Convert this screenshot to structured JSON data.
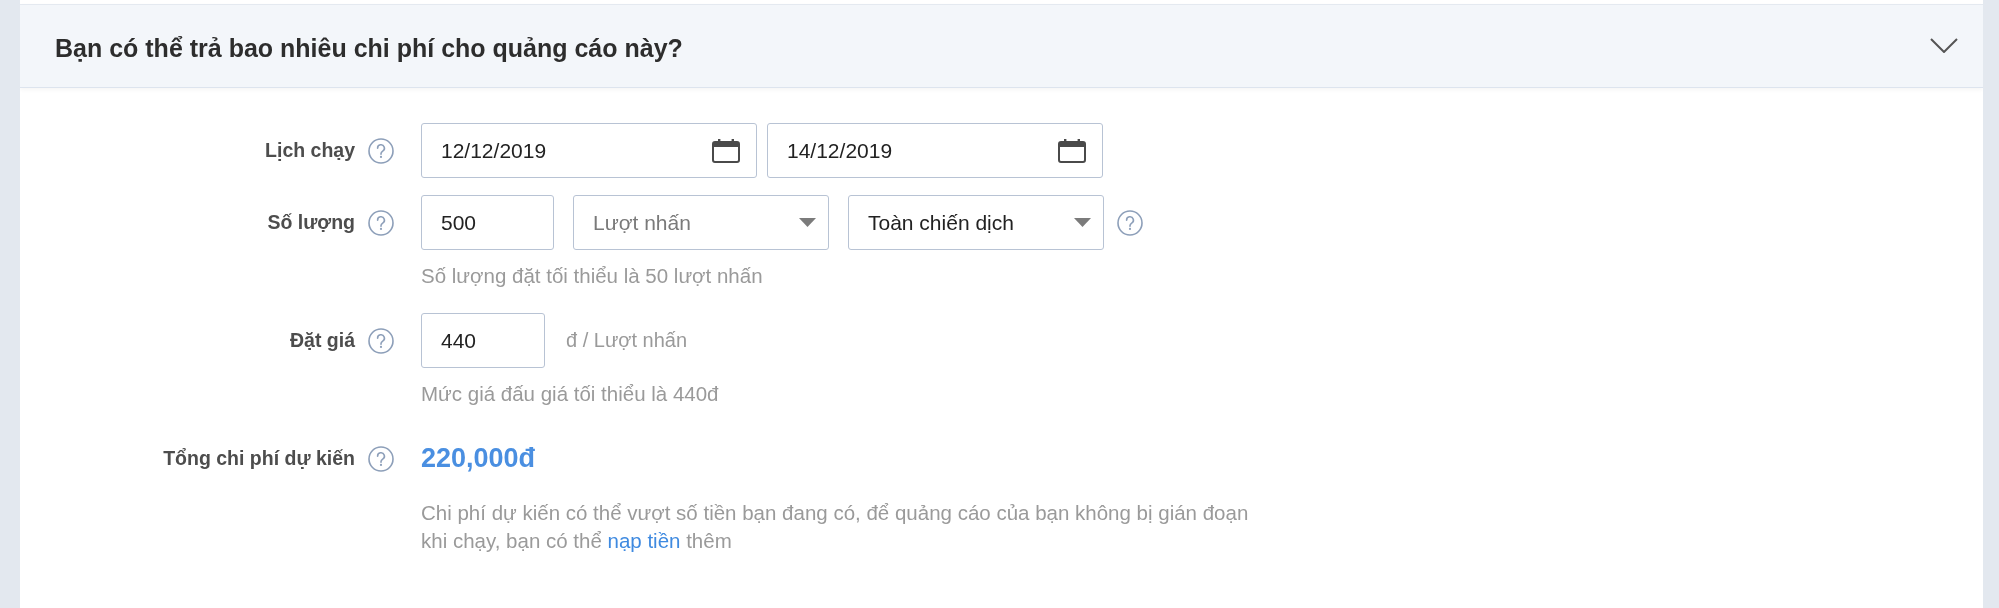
{
  "section": {
    "title": "Bạn có thể trả bao nhiêu chi phí cho quảng cáo này?",
    "expanded": true
  },
  "fields": [
    {
      "kind": "schedule",
      "label": "Lịch chạy",
      "inputs": [
        {
          "kind": "date",
          "value": "12/12/2019"
        },
        {
          "kind": "date",
          "value": "14/12/2019"
        }
      ]
    },
    {
      "kind": "quantity",
      "label": "Số lượng",
      "inputs": [
        {
          "kind": "number",
          "value": "500"
        },
        {
          "kind": "select",
          "value": "Lượt nhấn",
          "disabled": true
        },
        {
          "kind": "select",
          "value": "Toàn chiến dịch",
          "disabled": false
        },
        {
          "kind": "help"
        }
      ],
      "hint": "Số lượng đặt tối thiểu là 50 lượt nhấn"
    },
    {
      "kind": "price",
      "label": "Đặt giá",
      "inputs": [
        {
          "kind": "number",
          "value": "440"
        },
        {
          "kind": "unit",
          "text": "đ / Lượt nhấn"
        }
      ],
      "hint": "Mức giá đấu giá tối thiểu là 440đ"
    },
    {
      "kind": "total",
      "label": "Tổng chi phí dự kiến",
      "amount": "220,000đ",
      "note": {
        "text": "Chi phí dự kiến có thể vượt số tiền bạn đang có, để quảng cáo của bạn không bị gián đoạn khi chạy, bạn có thể",
        "link": "nạp tiền",
        "after": "thêm"
      }
    }
  ]
}
